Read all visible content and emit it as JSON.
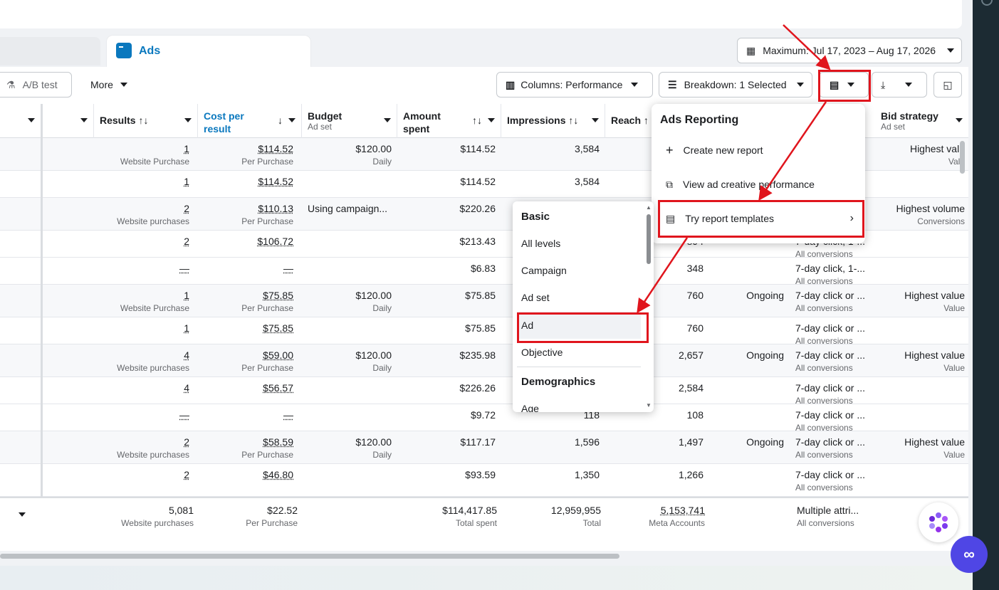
{
  "tabs": {
    "ads": "Ads"
  },
  "date_range": "Maximum: Jul 17, 2023 – Aug 17, 2026",
  "toolbar": {
    "ab_test": "A/B test",
    "more": "More",
    "columns": "Columns: Performance",
    "breakdown": "Breakdown: 1 Selected"
  },
  "headers": {
    "results": "Results ↑↓",
    "cost": "Cost per result",
    "budget": "Budget",
    "budget_sub": "Ad set",
    "amount": "Amount spent",
    "impressions": "Impressions ↑↓",
    "reach": "Reach ↑",
    "bid": "Bid strategy",
    "bid_sub": "Ad set"
  },
  "rows": [
    {
      "results": "1",
      "results_sub": "Website Purchase",
      "cost": "$114.52",
      "cost_sub": "Per Purchase",
      "budget": "$120.00",
      "budget_sub": "Daily",
      "amount": "$114.52",
      "impr": "3,584",
      "reach": "",
      "status": "",
      "attr": "",
      "attr_sub": "",
      "bid": "Highest valu",
      "bid_sub": "Valu"
    },
    {
      "results": "1",
      "results_sub": "",
      "cost": "$114.52",
      "cost_sub": "",
      "budget": "",
      "budget_sub": "",
      "amount": "$114.52",
      "impr": "3,584",
      "reach": "",
      "status": "",
      "attr": "",
      "attr_sub": "",
      "bid": "",
      "bid_sub": ""
    },
    {
      "results": "2",
      "results_sub": "Website purchases",
      "cost": "$110.13",
      "cost_sub": "Per Purchase",
      "budget": "Using campaign...",
      "budget_sub": "",
      "amount": "$220.26",
      "impr": "",
      "reach": "",
      "status": "",
      "attr": "",
      "attr_sub": "",
      "bid": "Highest volume",
      "bid_sub": "Conversions"
    },
    {
      "results": "2",
      "results_sub": "",
      "cost": "$106.72",
      "cost_sub": "",
      "budget": "",
      "budget_sub": "",
      "amount": "$213.43",
      "impr": "",
      "reach": "894",
      "status": "",
      "attr": "7-day click, 1-...",
      "attr_sub": "All conversions",
      "bid": "",
      "bid_sub": ""
    },
    {
      "results": "—",
      "results_sub": "",
      "cost": "—",
      "cost_sub": "",
      "budget": "",
      "budget_sub": "",
      "amount": "$6.83",
      "impr": "",
      "reach": "348",
      "status": "",
      "attr": "7-day click, 1-...",
      "attr_sub": "All conversions",
      "bid": "",
      "bid_sub": ""
    },
    {
      "results": "1",
      "results_sub": "Website Purchase",
      "cost": "$75.85",
      "cost_sub": "Per Purchase",
      "budget": "$120.00",
      "budget_sub": "Daily",
      "amount": "$75.85",
      "impr": "",
      "reach": "760",
      "status": "Ongoing",
      "attr": "7-day click or ...",
      "attr_sub": "All conversions",
      "bid": "Highest value",
      "bid_sub": "Value"
    },
    {
      "results": "1",
      "results_sub": "",
      "cost": "$75.85",
      "cost_sub": "",
      "budget": "",
      "budget_sub": "",
      "amount": "$75.85",
      "impr": "",
      "reach": "760",
      "status": "",
      "attr": "7-day click or ...",
      "attr_sub": "All conversions",
      "bid": "",
      "bid_sub": ""
    },
    {
      "results": "4",
      "results_sub": "Website purchases",
      "cost": "$59.00",
      "cost_sub": "Per Purchase",
      "budget": "$120.00",
      "budget_sub": "Daily",
      "amount": "$235.98",
      "impr": "",
      "reach": "2,657",
      "status": "Ongoing",
      "attr": "7-day click or ...",
      "attr_sub": "All conversions",
      "bid": "Highest value",
      "bid_sub": "Value"
    },
    {
      "results": "4",
      "results_sub": "",
      "cost": "$56.57",
      "cost_sub": "",
      "budget": "",
      "budget_sub": "",
      "amount": "$226.26",
      "impr": "",
      "reach": "2,584",
      "status": "",
      "attr": "7-day click or ...",
      "attr_sub": "All conversions",
      "bid": "",
      "bid_sub": ""
    },
    {
      "results": "—",
      "results_sub": "",
      "cost": "—",
      "cost_sub": "",
      "budget": "",
      "budget_sub": "",
      "amount": "$9.72",
      "impr": "118",
      "reach": "108",
      "status": "",
      "attr": "7-day click or ...",
      "attr_sub": "All conversions",
      "bid": "",
      "bid_sub": ""
    },
    {
      "results": "2",
      "results_sub": "Website purchases",
      "cost": "$58.59",
      "cost_sub": "Per Purchase",
      "budget": "$120.00",
      "budget_sub": "Daily",
      "amount": "$117.17",
      "impr": "1,596",
      "reach": "1,497",
      "status": "Ongoing",
      "attr": "7-day click or ...",
      "attr_sub": "All conversions",
      "bid": "Highest value",
      "bid_sub": "Value"
    },
    {
      "results": "2",
      "results_sub": "",
      "cost": "$46.80",
      "cost_sub": "",
      "budget": "",
      "budget_sub": "",
      "amount": "$93.59",
      "impr": "1,350",
      "reach": "1,266",
      "status": "",
      "attr": "7-day click or ...",
      "attr_sub": "All conversions",
      "bid": "",
      "bid_sub": ""
    }
  ],
  "totals": {
    "results": "5,081",
    "results_sub": "Website purchases",
    "cost": "$22.52",
    "cost_sub": "Per Purchase",
    "amount": "$114,417.85",
    "amount_sub": "Total spent",
    "impr": "12,959,955",
    "impr_sub": "Total",
    "reach": "5,153,741",
    "reach_sub": "Meta Accounts",
    "attr": "Multiple attri...",
    "attr_sub": "All conversions"
  },
  "menu": {
    "title": "Ads Reporting",
    "create": "Create new report",
    "view": "View ad creative performance",
    "templates": "Try report templates"
  },
  "submenu": {
    "basic": "Basic",
    "all_levels": "All levels",
    "campaign": "Campaign",
    "ad_set": "Ad set",
    "ad": "Ad",
    "objective": "Objective",
    "demographics": "Demographics",
    "age": "Age"
  }
}
